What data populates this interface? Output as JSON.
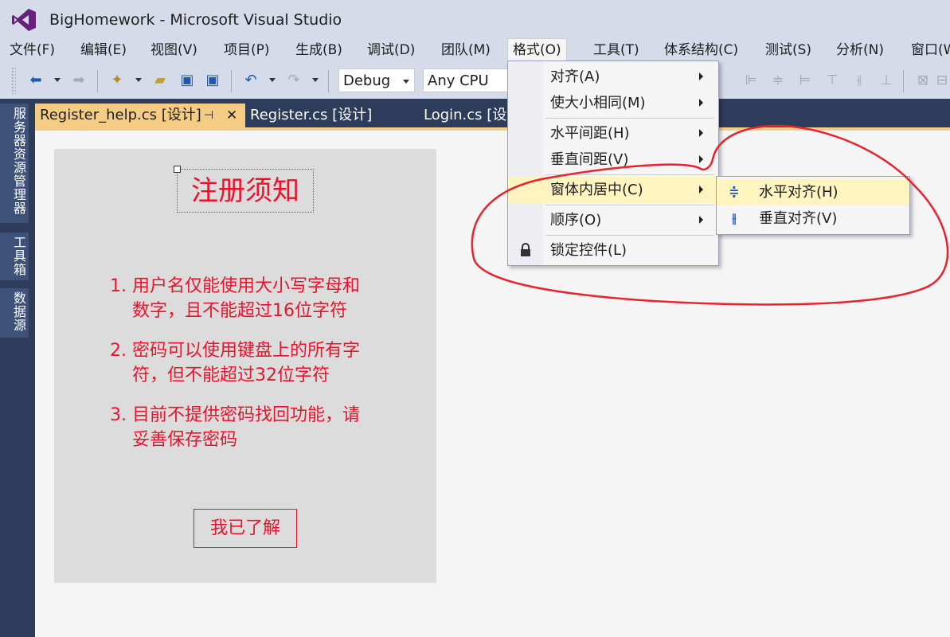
{
  "window": {
    "title": "BigHomework - Microsoft Visual Studio"
  },
  "menubar": {
    "items": [
      "文件(F)",
      "编辑(E)",
      "视图(V)",
      "项目(P)",
      "生成(B)",
      "调试(D)",
      "团队(M)",
      "格式(O)",
      "工具(T)",
      "体系结构(C)",
      "测试(S)",
      "分析(N)",
      "窗口(W)"
    ],
    "open_menu": "格式(O)"
  },
  "toolbar": {
    "config_value": "Debug",
    "platform_value": "Any CPU"
  },
  "left_dock": {
    "tabs": [
      "服务器资源管理器",
      "工具箱",
      "数据源"
    ]
  },
  "doc_tabs": {
    "items": [
      "Register_help.cs [设计]",
      "Register.cs [设计]",
      "Login.cs [设计]"
    ],
    "active": "Register_help.cs [设计]",
    "pin_glyph": "⊣",
    "close_glyph": "✕"
  },
  "form": {
    "title": "注册须知",
    "rules": [
      {
        "num": "1.",
        "lines": [
          "用户名仅能使用大小写字母和",
          "数字，且不能超过16位字符"
        ]
      },
      {
        "num": "2.",
        "lines": [
          "密码可以使用键盘上的所有字",
          "符，但不能超过32位字符"
        ]
      },
      {
        "num": "3.",
        "lines": [
          "目前不提供密码找回功能，请",
          "妥善保存密码"
        ]
      }
    ],
    "button_label": "我已了解"
  },
  "format_menu": {
    "items": [
      "对齐(A)",
      "使大小相同(M)",
      "水平间距(H)",
      "垂直间距(V)",
      "窗体内居中(C)",
      "顺序(O)",
      "锁定控件(L)"
    ],
    "highlighted": "窗体内居中(C)"
  },
  "center_submenu": {
    "items": [
      "水平对齐(H)",
      "垂直对齐(V)"
    ],
    "highlighted": "水平对齐(H)"
  },
  "colors": {
    "accent_tab": "#f5cc84",
    "form_text": "#e8142c",
    "menu_highlight": "#fdf4bf",
    "annotation": "#e8232f"
  }
}
